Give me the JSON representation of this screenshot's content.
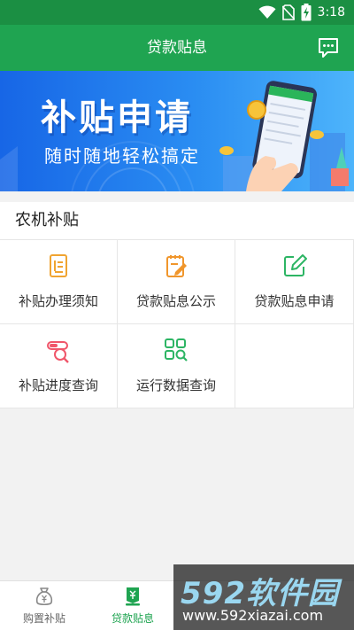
{
  "status_bar": {
    "time": "3:18",
    "icons": [
      "wifi-icon",
      "no-sim-icon",
      "battery-charging-icon"
    ]
  },
  "header": {
    "title": "贷款贴息",
    "message_icon": "chat-bubble-icon"
  },
  "banner": {
    "title": "补贴申请",
    "subtitle": "随时随地轻松搞定"
  },
  "section": {
    "title": "农机补贴",
    "items": [
      {
        "label": "补贴办理须知",
        "icon": "document-icon",
        "color": "#f0a431"
      },
      {
        "label": "贷款贴息公示",
        "icon": "notepad-edit-icon",
        "color": "#f0962c"
      },
      {
        "label": "贷款贴息申请",
        "icon": "edit-square-icon",
        "color": "#2db564"
      },
      {
        "label": "补贴进度查询",
        "icon": "progress-search-icon",
        "color": "#f0566a"
      },
      {
        "label": "运行数据查询",
        "icon": "grid-search-icon",
        "color": "#2db564"
      }
    ]
  },
  "tabbar": {
    "items": [
      {
        "label": "购置补贴",
        "icon": "money-bag-icon",
        "active": false
      },
      {
        "label": "贷款贴息",
        "icon": "loan-icon",
        "active": true
      }
    ]
  },
  "watermark": {
    "logo": "592软件园",
    "url": "www.592xiazai.com"
  },
  "colors": {
    "primary": "#1fa451",
    "status_bar": "#1b8f43",
    "banner_blue": "#1f77ec"
  }
}
